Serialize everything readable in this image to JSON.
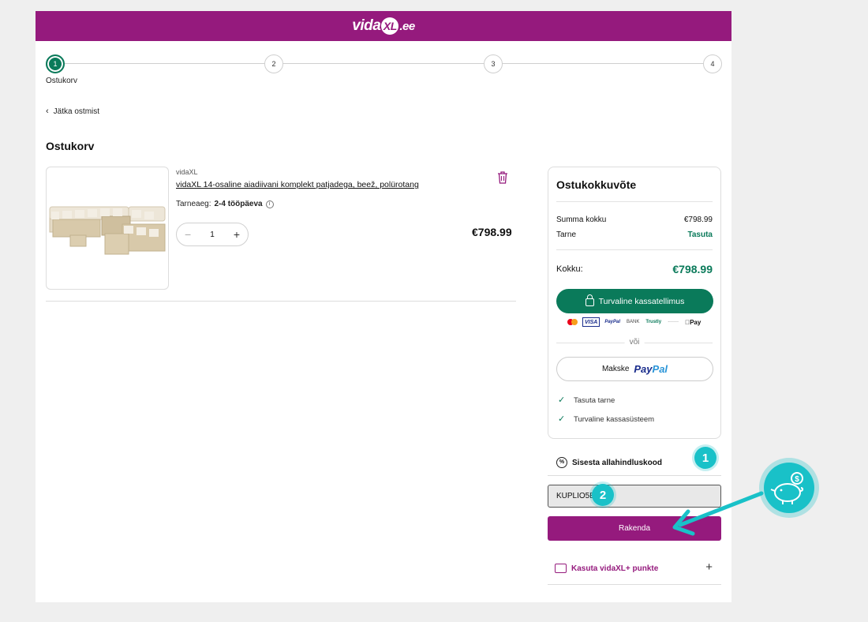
{
  "header": {
    "logo_prefix": "vida",
    "logo_mark": "XL",
    "logo_suffix": ".ee"
  },
  "stepper": {
    "steps": [
      "1",
      "2",
      "3",
      "4"
    ],
    "active_label": "Ostukorv"
  },
  "nav": {
    "back_label": "Jätka ostmist"
  },
  "page_title": "Ostukorv",
  "product": {
    "brand": "vidaXL",
    "name": "vidaXL 14-osaline aiadiivani komplekt patjadega, beež, polürotang",
    "delivery_label": "Tarneaeg:",
    "delivery_value": "2-4 tööpäeva",
    "quantity": "1",
    "price": "€798.99"
  },
  "summary": {
    "title": "Ostukokkuvõte",
    "subtotal_label": "Summa kokku",
    "subtotal_value": "€798.99",
    "shipping_label": "Tarne",
    "shipping_value": "Tasuta",
    "total_label": "Kokku:",
    "total_value": "€798.99",
    "checkout_label": "Turvaline kassatellimus",
    "payment_icons": [
      "mastercard-icon",
      "visa-icon",
      "paypal-icon",
      "bank-transfer-icon",
      "trustly-icon",
      "klarna-icon",
      "apple-pay-icon"
    ],
    "payment_labels": {
      "visa": "VISA",
      "paypal": "PayPal",
      "bank": "BANK",
      "trustly": "Trustly",
      "klarna": "·······",
      "apple": "Pay"
    },
    "or_label": "või",
    "paypal_prefix": "Makske",
    "paypal_brand_a": "Pay",
    "paypal_brand_b": "Pal",
    "benefits": [
      "Tasuta tarne",
      "Turvaline kassasüsteem"
    ]
  },
  "discount": {
    "label": "Sisesta allahindluskood",
    "code_value": "KUPLIO5E",
    "apply_label": "Rakenda"
  },
  "points": {
    "label": "Kasuta vidaXL+ punkte"
  },
  "annotations": {
    "badge_1": "1",
    "badge_2": "2"
  },
  "colors": {
    "brand": "#951a7d",
    "green": "#0a7a5a",
    "annotation": "#19c1c8"
  }
}
